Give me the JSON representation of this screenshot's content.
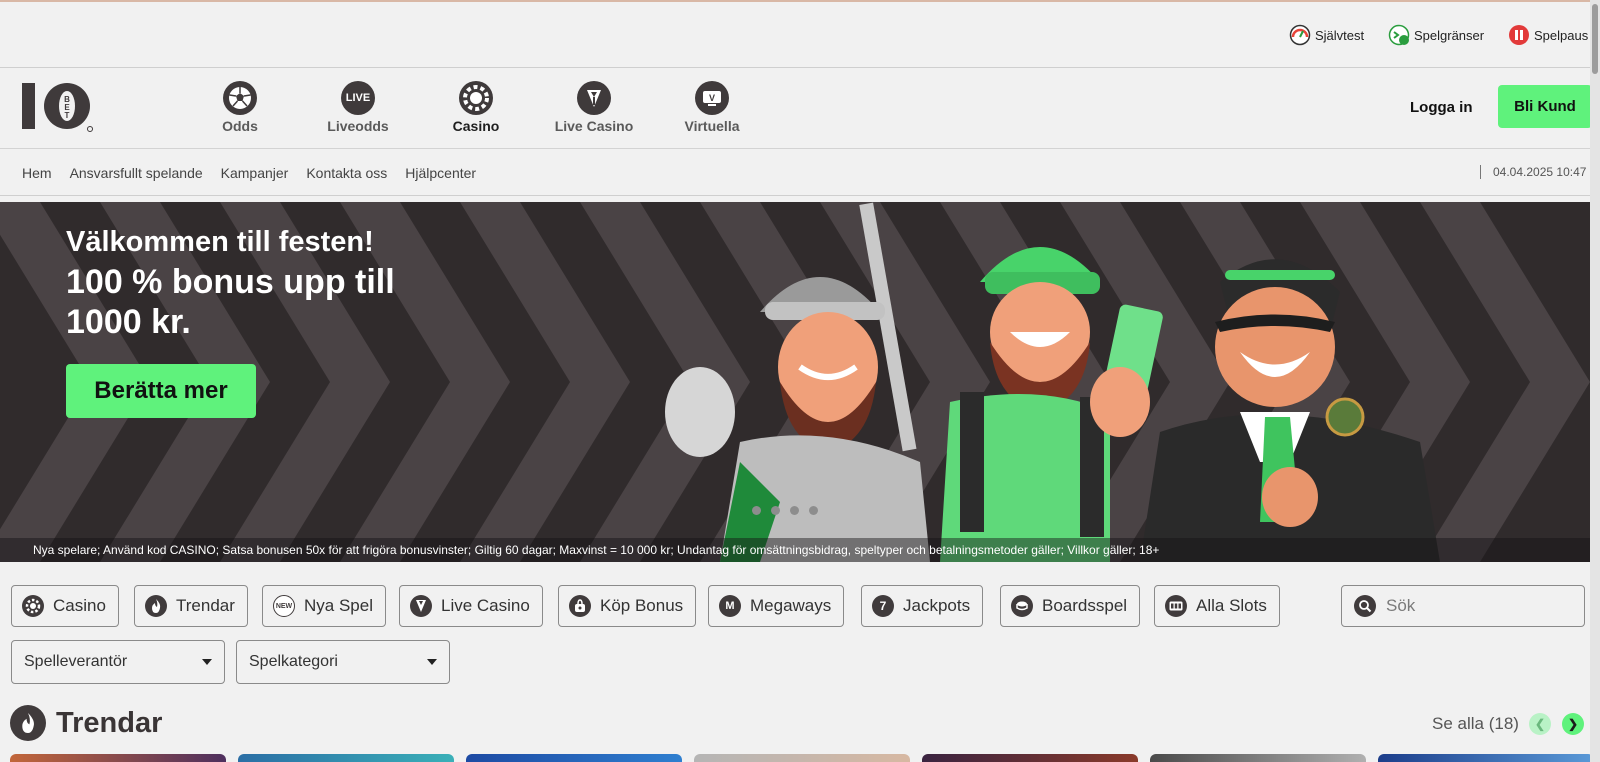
{
  "utility": {
    "self_test": "Självtest",
    "limits": "Spelgränser",
    "pause": "Spelpaus"
  },
  "brand": {
    "logo_text": "10 BET"
  },
  "nav": {
    "items": [
      {
        "label": "Odds",
        "icon": "soccer-ball-icon"
      },
      {
        "label": "Liveodds",
        "icon": "live-icon",
        "badge": "LIVE"
      },
      {
        "label": "Casino",
        "icon": "casino-chip-icon"
      },
      {
        "label": "Live Casino",
        "icon": "dealer-icon"
      },
      {
        "label": "Virtuella",
        "icon": "virtual-tv-icon",
        "badge": "V"
      }
    ],
    "active": "Casino",
    "login": "Logga in",
    "signup": "Bli Kund"
  },
  "subnav": {
    "links": [
      "Hem",
      "Ansvarsfullt spelande",
      "Kampanjer",
      "Kontakta oss",
      "Hjälpcenter"
    ],
    "datetime": "04.04.2025 10:47"
  },
  "banner": {
    "headline": "Välkommen till festen!",
    "offer": "100 % bonus upp till 1000 kr.",
    "cta": "Berätta mer",
    "terms": "Nya spelare; Använd kod CASINO; Satsa bonusen 50x för att frigöra bonusvinster; Giltig 60 dagar; Maxvinst = 10 000 kr; Undantag för omsättningsbidrag, speltyper och betalningsmetoder gäller; Villkor gäller; 18+"
  },
  "filters": {
    "chips": [
      {
        "label": "Casino",
        "icon": "casino-chip-icon"
      },
      {
        "label": "Trendar",
        "icon": "flame-icon"
      },
      {
        "label": "Nya Spel",
        "icon": "new-icon",
        "badge": "NEW"
      },
      {
        "label": "Live Casino",
        "icon": "dealer-icon"
      },
      {
        "label": "Köp Bonus",
        "icon": "bag-icon"
      },
      {
        "label": "Megaways",
        "icon": "megaways-icon",
        "badge": "M"
      },
      {
        "label": "Jackpots",
        "icon": "seven-icon",
        "badge": "7"
      },
      {
        "label": "Boardsspel",
        "icon": "token-icon"
      },
      {
        "label": "Alla Slots",
        "icon": "slots-icon"
      }
    ],
    "search_placeholder": "Sök",
    "provider": "Spelleverantör",
    "category": "Spelkategori"
  },
  "section": {
    "title": "Trendar",
    "see_all": "Se alla (18)"
  },
  "colors": {
    "accent": "#5ff27c",
    "dark": "#302b2c",
    "icon": "#403b3c"
  }
}
